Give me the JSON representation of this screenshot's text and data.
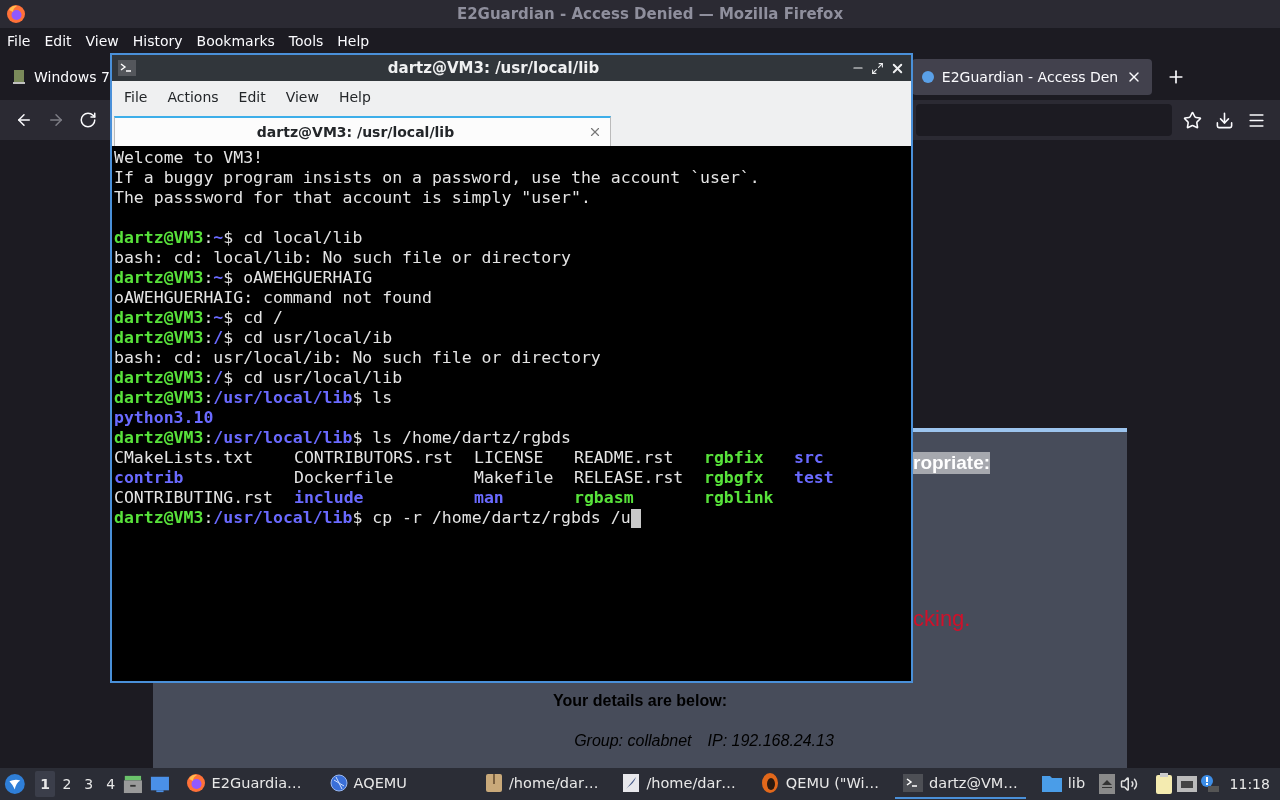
{
  "firefox": {
    "title": "E2Guardian - Access Denied — Mozilla Firefox",
    "menu": [
      "File",
      "Edit",
      "View",
      "History",
      "Bookmarks",
      "Tools",
      "Help"
    ],
    "tabs": [
      {
        "label": "Windows 7",
        "selected": false
      },
      {
        "label": "E2Guardian - Access Den",
        "selected": true
      }
    ],
    "page": {
      "fragment_top": "ropriate:",
      "fragment_warning": "cking.",
      "details_heading": "Your details are below:",
      "group": "Group: collabnet",
      "ip": "IP: 192.168.24.13"
    }
  },
  "terminal": {
    "title": "dartz@VM3: /usr/local/lib",
    "menu": [
      "File",
      "Actions",
      "Edit",
      "View",
      "Help"
    ],
    "tab": {
      "label": "dartz@VM3: /usr/local/lib"
    },
    "lines": [
      {
        "kind": "text",
        "segments": [
          {
            "text": "Welcome to VM3!",
            "kind": "plain"
          }
        ]
      },
      {
        "kind": "text",
        "segments": [
          {
            "text": "If a buggy program insists on a password, use the account `user`.",
            "kind": "plain"
          }
        ]
      },
      {
        "kind": "text",
        "segments": [
          {
            "text": "The passsword for that account is simply \"user\".",
            "kind": "plain"
          }
        ]
      },
      {
        "kind": "blank"
      },
      {
        "kind": "text",
        "segments": [
          {
            "text": "dartz@VM3",
            "kind": "user"
          },
          {
            "text": ":",
            "kind": "plain"
          },
          {
            "text": "~",
            "kind": "path"
          },
          {
            "text": "$ cd local/lib",
            "kind": "plain"
          }
        ]
      },
      {
        "kind": "text",
        "segments": [
          {
            "text": "bash: cd: local/lib: No such file or directory",
            "kind": "plain"
          }
        ]
      },
      {
        "kind": "text",
        "segments": [
          {
            "text": "dartz@VM3",
            "kind": "user"
          },
          {
            "text": ":",
            "kind": "plain"
          },
          {
            "text": "~",
            "kind": "path"
          },
          {
            "text": "$ oAWEHGUERHAIG",
            "kind": "plain"
          }
        ]
      },
      {
        "kind": "text",
        "segments": [
          {
            "text": "oAWEHGUERHAIG: command not found",
            "kind": "plain"
          }
        ]
      },
      {
        "kind": "text",
        "segments": [
          {
            "text": "dartz@VM3",
            "kind": "user"
          },
          {
            "text": ":",
            "kind": "plain"
          },
          {
            "text": "~",
            "kind": "path"
          },
          {
            "text": "$ cd /",
            "kind": "plain"
          }
        ]
      },
      {
        "kind": "text",
        "segments": [
          {
            "text": "dartz@VM3",
            "kind": "user"
          },
          {
            "text": ":",
            "kind": "plain"
          },
          {
            "text": "/",
            "kind": "path"
          },
          {
            "text": "$ cd usr/local/ib",
            "kind": "plain"
          }
        ]
      },
      {
        "kind": "text",
        "segments": [
          {
            "text": "bash: cd: usr/local/ib: No such file or directory",
            "kind": "plain"
          }
        ]
      },
      {
        "kind": "text",
        "segments": [
          {
            "text": "dartz@VM3",
            "kind": "user"
          },
          {
            "text": ":",
            "kind": "plain"
          },
          {
            "text": "/",
            "kind": "path"
          },
          {
            "text": "$ cd usr/local/lib",
            "kind": "plain"
          }
        ]
      },
      {
        "kind": "text",
        "segments": [
          {
            "text": "dartz@VM3",
            "kind": "user"
          },
          {
            "text": ":",
            "kind": "plain"
          },
          {
            "text": "/usr/local/lib",
            "kind": "path"
          },
          {
            "text": "$ ls",
            "kind": "plain"
          }
        ]
      },
      {
        "kind": "text",
        "segments": [
          {
            "text": "python3.10",
            "kind": "dir"
          }
        ]
      },
      {
        "kind": "text",
        "segments": [
          {
            "text": "dartz@VM3",
            "kind": "user"
          },
          {
            "text": ":",
            "kind": "plain"
          },
          {
            "text": "/usr/local/lib",
            "kind": "path"
          },
          {
            "text": "$ ls /home/dartz/rgbds",
            "kind": "plain"
          }
        ]
      },
      {
        "kind": "columns",
        "cells": [
          {
            "text": "CMakeLists.txt",
            "kind": "plain"
          },
          {
            "text": "CONTRIBUTORS.rst",
            "kind": "plain"
          },
          {
            "text": "LICENSE",
            "kind": "plain"
          },
          {
            "text": "README.rst",
            "kind": "plain"
          },
          {
            "text": "rgbfix",
            "kind": "exec"
          },
          {
            "text": "src",
            "kind": "dir"
          }
        ]
      },
      {
        "kind": "columns",
        "cells": [
          {
            "text": "contrib",
            "kind": "dir"
          },
          {
            "text": "Dockerfile",
            "kind": "plain"
          },
          {
            "text": "Makefile",
            "kind": "plain"
          },
          {
            "text": "RELEASE.rst",
            "kind": "plain"
          },
          {
            "text": "rgbgfx",
            "kind": "exec"
          },
          {
            "text": "test",
            "kind": "dir"
          }
        ]
      },
      {
        "kind": "columns",
        "cells": [
          {
            "text": "CONTRIBUTING.rst",
            "kind": "plain"
          },
          {
            "text": "include",
            "kind": "dir"
          },
          {
            "text": "man",
            "kind": "dir"
          },
          {
            "text": "rgbasm",
            "kind": "exec"
          },
          {
            "text": "rgblink",
            "kind": "exec"
          }
        ]
      },
      {
        "kind": "text",
        "cursor": true,
        "segments": [
          {
            "text": "dartz@VM3",
            "kind": "user"
          },
          {
            "text": ":",
            "kind": "plain"
          },
          {
            "text": "/usr/local/lib",
            "kind": "path"
          },
          {
            "text": "$ cp -r /home/dartz/rgbds /u",
            "kind": "plain"
          }
        ]
      }
    ]
  },
  "taskbar": {
    "workspaces": [
      {
        "label": "1",
        "selected": true
      },
      {
        "label": "2",
        "selected": false
      },
      {
        "label": "3",
        "selected": false
      },
      {
        "label": "4",
        "selected": false
      }
    ],
    "tasks": [
      {
        "label": "E2Guardia…",
        "kind": "firefox",
        "selected": false
      },
      {
        "label": "AQEMU",
        "kind": "aqemu",
        "selected": false
      },
      {
        "label": "/home/dar…",
        "kind": "archive",
        "selected": false
      },
      {
        "label": "/home/dar…",
        "kind": "editor",
        "selected": false
      },
      {
        "label": "QEMU (\"Wi…",
        "kind": "qemu",
        "selected": false
      },
      {
        "label": "dartz@VM…",
        "kind": "terminal",
        "selected": true
      },
      {
        "label": "lib",
        "kind": "folder",
        "selected": false
      }
    ],
    "clock": "11:18"
  }
}
